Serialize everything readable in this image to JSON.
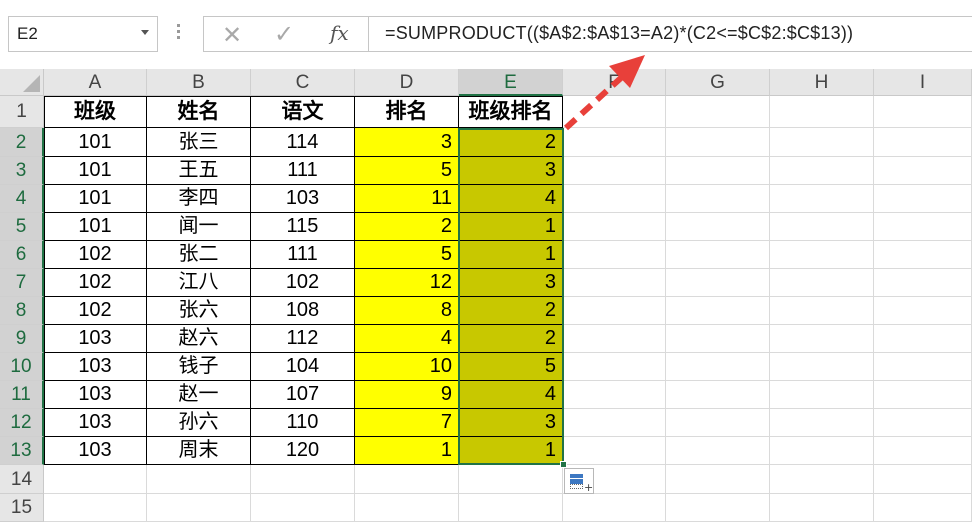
{
  "name_box": {
    "value": "E2"
  },
  "formula_bar": {
    "cancel_icon": "close-icon",
    "enter_icon": "check-icon",
    "function_label": "fx",
    "formula": "=SUMPRODUCT(($A$2:$A$13=A2)*(C2<=$C$2:$C$13))"
  },
  "columns": [
    "A",
    "B",
    "C",
    "D",
    "E",
    "F",
    "G",
    "H",
    "I"
  ],
  "rows": [
    "1",
    "2",
    "3",
    "4",
    "5",
    "6",
    "7",
    "8",
    "9",
    "10",
    "11",
    "12",
    "13",
    "14",
    "15"
  ],
  "selected_cell": "E2",
  "table": {
    "headers": [
      "班级",
      "姓名",
      "语文",
      "排名",
      "班级排名"
    ],
    "data": [
      [
        "101",
        "张三",
        "114",
        "3",
        "2"
      ],
      [
        "101",
        "王五",
        "111",
        "5",
        "3"
      ],
      [
        "101",
        "李四",
        "103",
        "11",
        "4"
      ],
      [
        "101",
        "闻一",
        "115",
        "2",
        "1"
      ],
      [
        "102",
        "张二",
        "111",
        "5",
        "1"
      ],
      [
        "102",
        "江八",
        "102",
        "12",
        "3"
      ],
      [
        "102",
        "张六",
        "108",
        "8",
        "2"
      ],
      [
        "103",
        "赵六",
        "112",
        "4",
        "2"
      ],
      [
        "103",
        "钱子",
        "104",
        "10",
        "5"
      ],
      [
        "103",
        "赵一",
        "107",
        "9",
        "4"
      ],
      [
        "103",
        "孙六",
        "110",
        "7",
        "3"
      ],
      [
        "103",
        "周末",
        "120",
        "1",
        "1"
      ]
    ]
  },
  "colors": {
    "rank_fill": "#ffff00",
    "class_rank_fill": "#c8c800",
    "selection": "#217346",
    "arrow": "#e8403a"
  },
  "quick_analysis_icon": "quick-analysis-icon"
}
